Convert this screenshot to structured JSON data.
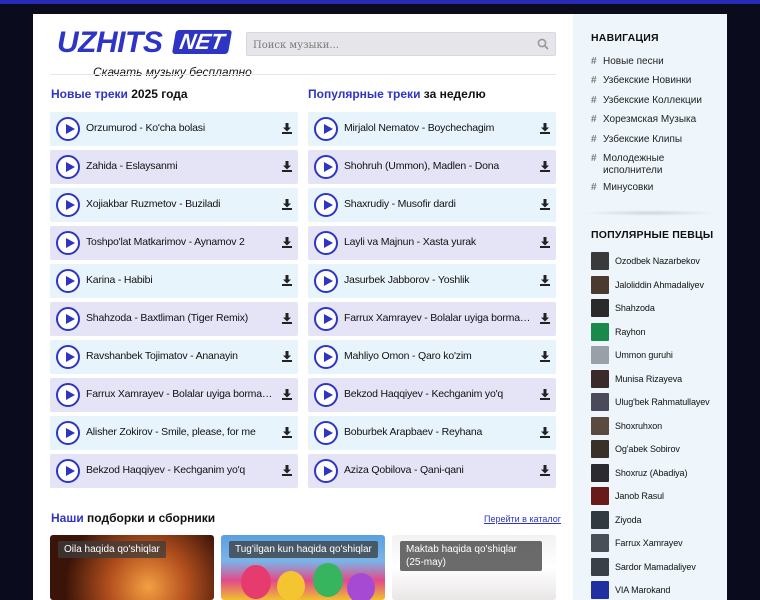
{
  "site": {
    "logo_main": "UZHITS",
    "logo_suffix": "NET",
    "tagline": "Скачать музыку бесплатно"
  },
  "search": {
    "placeholder": "Поиск музыки...",
    "icon": "search-icon"
  },
  "new_tracks": {
    "title_highlight": "Новые треки",
    "title_rest": " 2025 года",
    "items": [
      "Orzumurod - Ko'cha bolasi",
      "Zahida - Eslaysanmi",
      "Xojiakbar Ruzmetov - Buziladi",
      "Toshpo'lat Matkarimov - Aynamov 2",
      "Karina - Habibi",
      "Shahzoda - Baxtliman (Tiger Remix)",
      "Ravshanbek Tojimatov - Ananayin",
      "Farrux Xamrayev - Bolalar uyiga bormaysan (Yangi)",
      "Alisher Zokirov - Smile, please, for me",
      "Bekzod Haqqiyev - Kechganim yo'q"
    ]
  },
  "popular_tracks": {
    "title_highlight": "Популярные треки",
    "title_rest": " за неделю",
    "items": [
      "Mirjalol Nematov - Boychechagim",
      "Shohruh (Ummon), Madlen - Dona",
      "Shaxrudiy - Musofir dardi",
      "Layli va Majnun - Xasta yurak",
      "Jasurbek Jabborov - Yoshlik",
      "Farrux Xamrayev - Bolalar uyiga bormaysan (Yangi)",
      "Mahliyo Omon - Qaro ko'zim",
      "Bekzod Haqqiyev - Kechganim yo'q",
      "Boburbek Arapbaev - Reyhana",
      "Aziza Qobilova - Qani-qani"
    ]
  },
  "collections": {
    "title_highlight": "Наши",
    "title_rest": " подборки и сборники",
    "catalog_link": "Перейти в каталог",
    "cards": [
      "Oila haqida qo'shiqlar",
      "Tug'ilgan kun haqida qo'shiqlar",
      "Maktab haqida qo'shiqlar (25-may)"
    ]
  },
  "sidebar": {
    "nav_title": "НАВИГАЦИЯ",
    "nav_items": [
      "Новые песни",
      "Узбекские Новинки",
      "Узбекские Коллекции",
      "Хорезмская Музыка",
      "Узбекские Клипы",
      "Молодежные исполнители",
      "Минусовки"
    ],
    "singers_title": "ПОПУЛЯРНЫЕ ПЕВЦЫ",
    "singers": [
      "Ozodbek Nazarbekov",
      "Jaloliddin Ahmadaliyev",
      "Shahzoda",
      "Rayhon",
      "Ummon guruhi",
      "Munisa Rizayeva",
      "Ulug'bek Rahmatullayev",
      "Shoxruhxon",
      "Og'abek Sobirov",
      "Shoxruz (Abadiya)",
      "Janob Rasul",
      "Ziyoda",
      "Farrux Xamrayev",
      "Sardor Mamadaliyev",
      "VIA Marokand"
    ]
  },
  "colors": {
    "accent": "#2e34c4",
    "row_odd": "#e8f4fc",
    "row_even": "#e5e4f7",
    "sidebar_bg": "#eef6fb"
  }
}
